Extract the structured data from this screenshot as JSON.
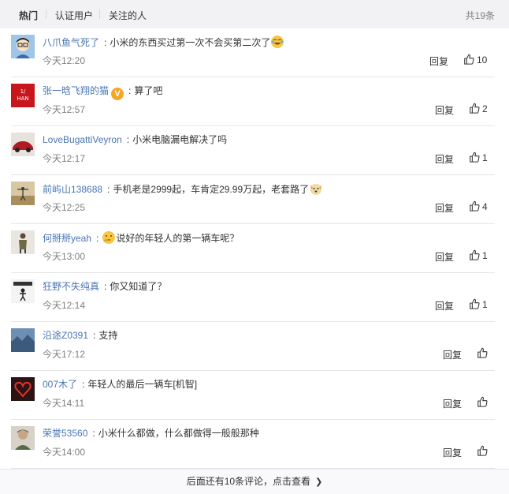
{
  "tabs": [
    {
      "label": "热门",
      "active": true
    },
    {
      "label": "认证用户",
      "active": false
    },
    {
      "label": "关注的人",
      "active": false
    }
  ],
  "total_label": "共19条",
  "reply_label": "回复",
  "comments": [
    {
      "username": "八爪鱼气死了",
      "text": "小米的东西买过第一次不会买第二次了",
      "time": "今天12:20",
      "likes": "10",
      "emoji": "laugh-cry"
    },
    {
      "username": "张一晗飞翔的猫",
      "text": "算了吧",
      "time": "今天12:57",
      "likes": "2",
      "badge": "V"
    },
    {
      "username": "LoveBugattiVeyron",
      "text": "小米电脑漏电解决了吗",
      "time": "今天12:17",
      "likes": "1"
    },
    {
      "username": "前屿山138688",
      "text": "手机老是2999起，车肯定29.99万起，老套路了",
      "time": "今天12:25",
      "likes": "4",
      "emoji": "dog"
    },
    {
      "username": "何掰掰yeah",
      "text": "说好的年轻人的第一辆车呢？",
      "time": "今天13:00",
      "likes": "1",
      "emoji_before": "thinking"
    },
    {
      "username": "狂野不失纯真",
      "text": "你又知道了？",
      "time": "今天12:14",
      "likes": "1"
    },
    {
      "username": "沿途Z0391",
      "text": "支持",
      "time": "今天17:12",
      "likes": ""
    },
    {
      "username": "007木了",
      "text": "年轻人的最后一辆车[机智]",
      "time": "今天14:11",
      "likes": ""
    },
    {
      "username": "荣誉53560",
      "text": "小米什么都做，什么都做得一般般那种",
      "time": "今天14:00",
      "likes": ""
    }
  ],
  "more_label": "后面还有10条评论，点击查看",
  "colors": {
    "link": "#4a75b5",
    "text": "#333333",
    "muted": "#808080",
    "tab_bg": "#f2f2f5"
  }
}
